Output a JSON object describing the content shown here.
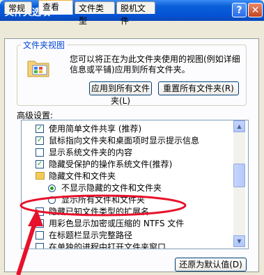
{
  "window": {
    "title": "文件夹选项",
    "help": "?",
    "close": "✕"
  },
  "tabs": [
    "常规",
    "查看",
    "文件类型",
    "脱机文件"
  ],
  "folder_views": {
    "legend": "文件夹视图",
    "description": "您可以将正在为此文件夹使用的视图(例如详细信息或平铺)应用到所有文件夹。",
    "apply_button": "应用到所有文件夹(L)",
    "reset_button": "重置所有文件夹(R)"
  },
  "advanced": {
    "label": "高级设置:",
    "items": [
      {
        "type": "checkbox",
        "checked": true,
        "text": "使用简单文件共享 (推荐)"
      },
      {
        "type": "checkbox",
        "checked": true,
        "text": "鼠标指向文件夹和桌面项时显示提示信息"
      },
      {
        "type": "checkbox",
        "checked": false,
        "text": "显示系统文件夹的内容"
      },
      {
        "type": "checkbox",
        "checked": true,
        "text": "隐藏受保护的操作系统文件(推荐)"
      },
      {
        "type": "folder",
        "text": "隐藏文件和文件夹"
      },
      {
        "type": "radio",
        "checked": true,
        "text": "不显示隐藏的文件和文件夹"
      },
      {
        "type": "radio",
        "checked": false,
        "text": "显示所有文件和文件夹"
      },
      {
        "type": "checkbox",
        "checked": false,
        "text": "隐藏已知文件类型的扩展名"
      },
      {
        "type": "checkbox",
        "checked": false,
        "text": "用彩色显示加密或压缩的 NTFS 文件"
      },
      {
        "type": "checkbox",
        "checked": false,
        "text": "在标题栏显示完整路径"
      },
      {
        "type": "checkbox",
        "checked": false,
        "text": "在单独的进程中打开文件夹窗口"
      }
    ]
  },
  "restore_button": "还原为默认值(D)",
  "colors": {
    "title_bar": "#0654d6",
    "annotation": "#e8102a",
    "check": "#21a121"
  }
}
